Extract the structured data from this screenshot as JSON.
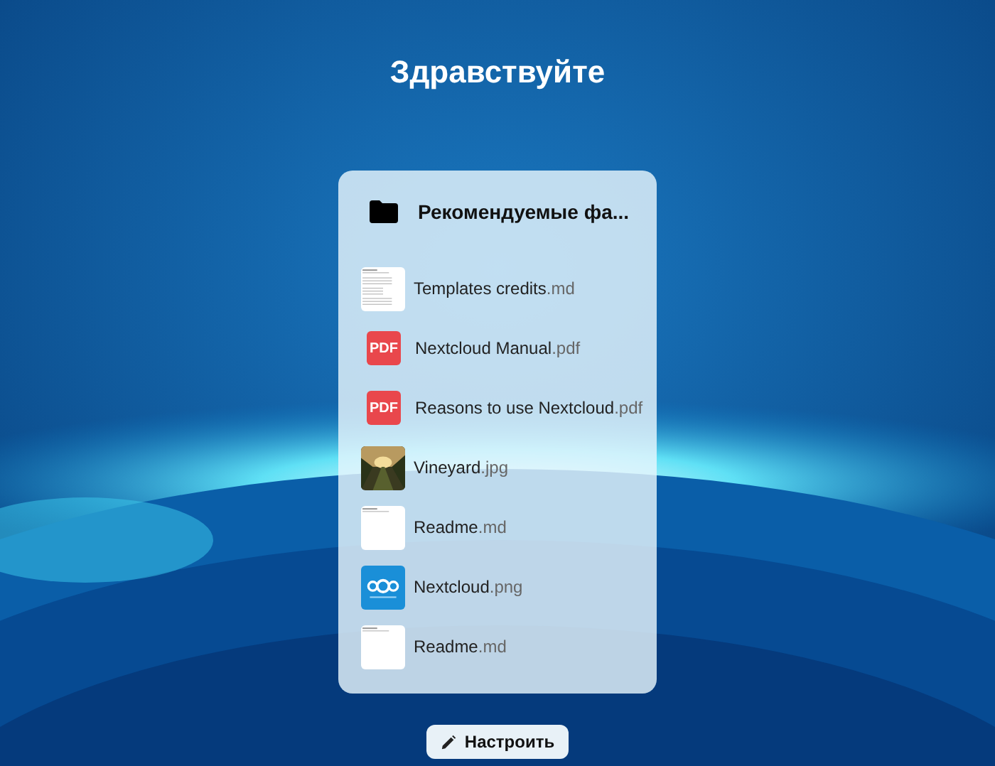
{
  "greeting": "Здравствуйте",
  "widget": {
    "title": "Рекомендуемые фа...",
    "files": [
      {
        "kind": "document",
        "name": "Templates credits",
        "extension": ".md"
      },
      {
        "kind": "pdf",
        "badge": "PDF",
        "name": "Nextcloud Manual",
        "extension": ".pdf"
      },
      {
        "kind": "pdf",
        "badge": "PDF",
        "name": "Reasons to use Nextcloud",
        "extension": ".pdf"
      },
      {
        "name": "Vineyard",
        "extension": ".jpg"
      },
      {
        "kind": "blank",
        "name": "Readme",
        "extension": ".md"
      },
      {
        "kind": "logo",
        "name": "Nextcloud",
        "extension": ".png"
      },
      {
        "kind": "blank",
        "name": "Readme",
        "extension": ".md"
      }
    ]
  },
  "customize_button": "Настроить"
}
